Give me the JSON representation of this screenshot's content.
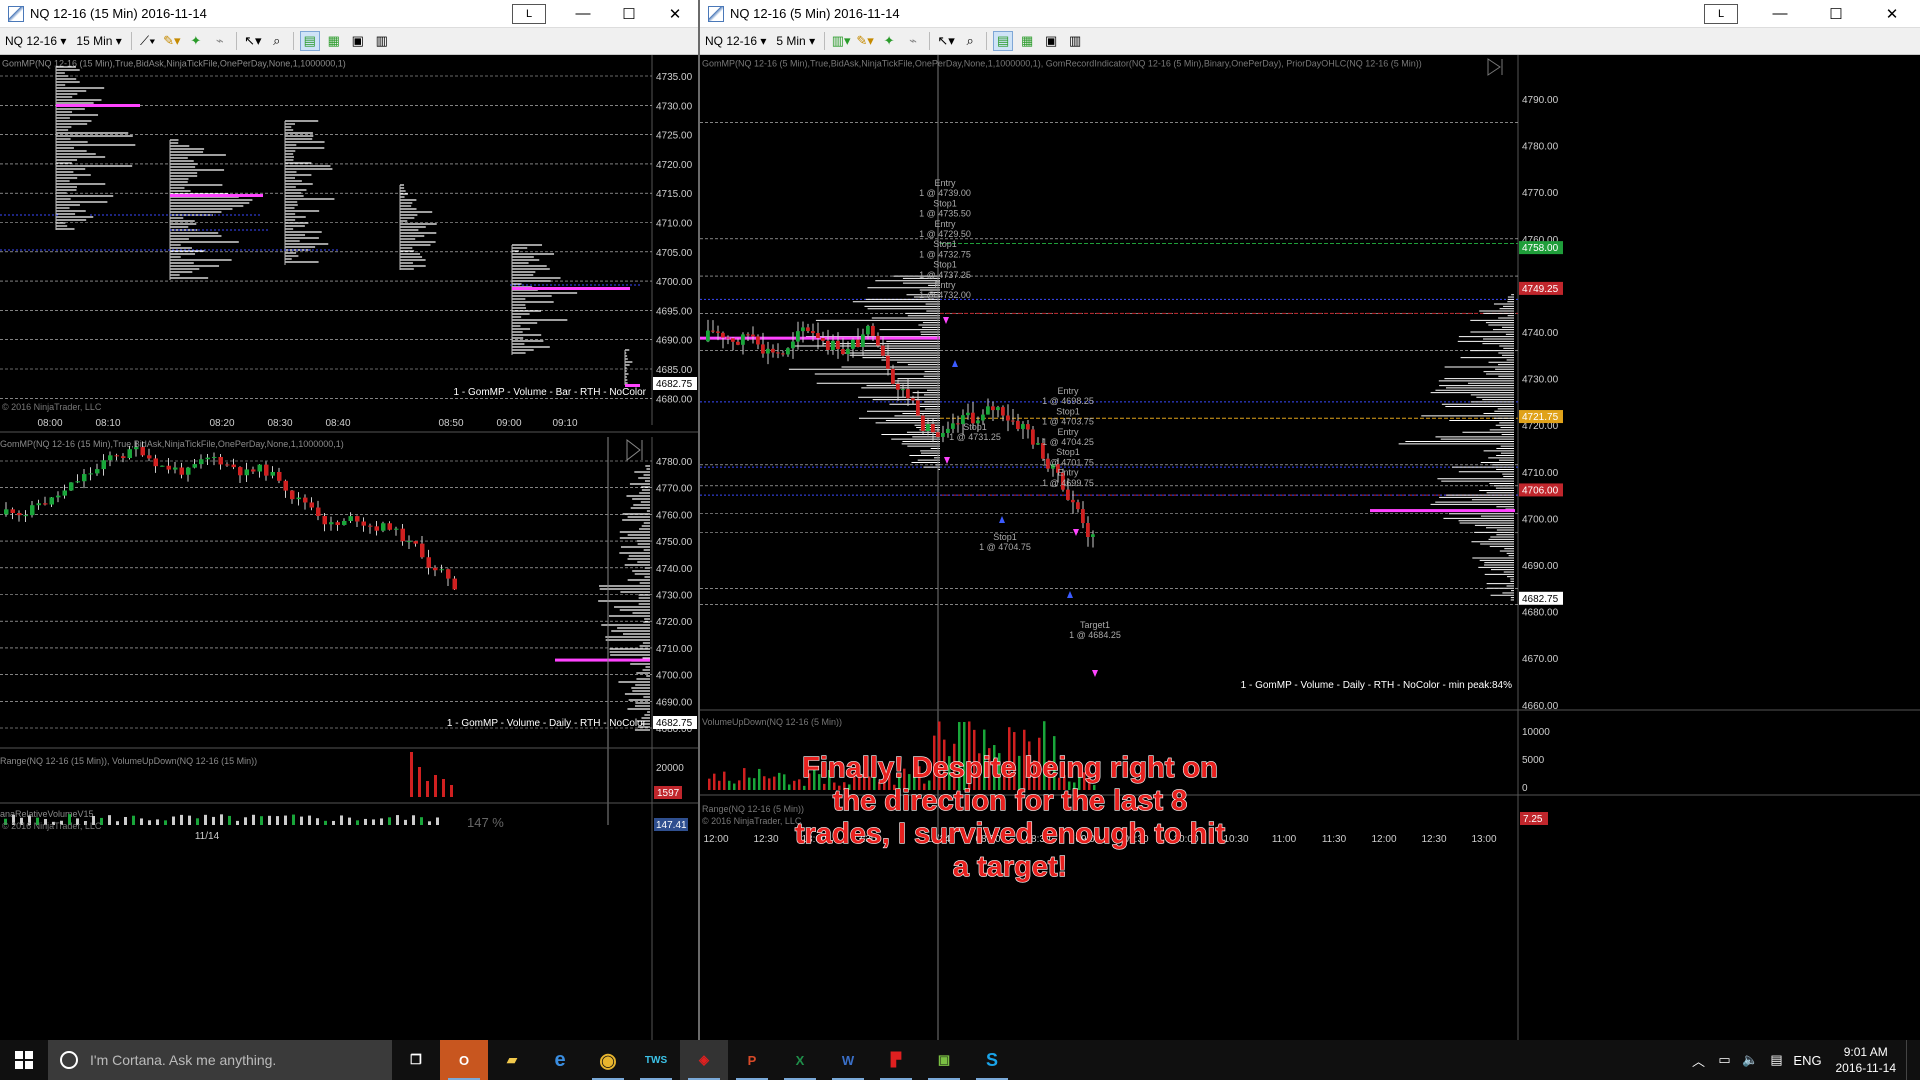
{
  "left_window": {
    "title": "NQ 12-16 (15 Min)  2016-11-14",
    "l_button": "L",
    "toolbar": {
      "instrument": "NQ 12-16",
      "interval": "15 Min"
    },
    "top_panel": {
      "indicator_header": "GomMP(NQ 12-16 (15 Min),True,BidAsk,NinjaTickFile,OnePerDay,None,1,1000000,1)",
      "price_ticks": [
        "4735.00",
        "4730.00",
        "4725.00",
        "4720.00",
        "4715.00",
        "4710.00",
        "4705.00",
        "4700.00",
        "4695.00",
        "4690.00",
        "4685.00",
        "4680.00"
      ],
      "last_price": "4682.75",
      "footer_label": "1 - GomMP - Volume - Bar - RTH - NoColor",
      "copyright": "© 2016 NinjaTrader, LLC",
      "time_ticks": [
        "08:00",
        "08:10",
        "08:20",
        "08:30",
        "08:40",
        "08:50",
        "09:00",
        "09:10"
      ]
    },
    "bottom_panel": {
      "indicator_header": "GomMP(NQ 12-16 (15 Min),True,BidAsk,NinjaTickFile,OnePerDay,None,1,1000000,1)",
      "price_ticks": [
        "4780.00",
        "4770.00",
        "4760.00",
        "4750.00",
        "4740.00",
        "4730.00",
        "4720.00",
        "4710.00",
        "4700.00",
        "4690.00",
        "4680.00"
      ],
      "last_price": "4682.75",
      "footer_label": "1 - GomMP - Volume - Daily - RTH - NoColor",
      "range_header": "Range(NQ 12-16 (15 Min)), VolumeUpDown(NQ 12-16 (15 Min))",
      "range_tick": "20000",
      "range_value": "1597",
      "rel_header": "anaRelativeVolumeV15",
      "copyright": "© 2016 NinjaTrader, LLC",
      "rel_pct": "147 %",
      "rel_value": "147.41",
      "date_tick": "11/14"
    }
  },
  "right_window": {
    "title": "NQ 12-16 (5 Min)  2016-11-14",
    "l_button": "L",
    "toolbar": {
      "instrument": "NQ 12-16",
      "interval": "5 Min"
    },
    "panel": {
      "indicator_header": "GomMP(NQ 12-16 (5 Min),True,BidAsk,NinjaTickFile,OnePerDay,None,1,1000000,1), GomRecordIndicator(NQ 12-16 (5 Min),Binary,OnePerDay), PriorDayOHLC(NQ 12-16 (5 Min))",
      "price_ticks": [
        "4790.00",
        "4780.00",
        "4770.00",
        "4760.00",
        "4750.00",
        "4740.00",
        "4730.00",
        "4720.00",
        "4710.00",
        "4700.00",
        "4690.00",
        "4680.00",
        "4670.00",
        "4660.00"
      ],
      "flags": [
        {
          "text": "4758.00",
          "color": "#1f9e3a"
        },
        {
          "text": "4749.25",
          "color": "#c0262c"
        },
        {
          "text": "4721.75",
          "color": "#e0a21a"
        },
        {
          "text": "4706.00",
          "color": "#c0262c"
        },
        {
          "text": "4682.75",
          "color": "#ffffff"
        }
      ],
      "footer_label": "1 - GomMP - Volume - Daily - RTH - NoColor - min peak:84%",
      "trade_labels": [
        [
          "Entry",
          "1 @ 4739.00",
          "Stop1",
          "1 @ 4735.50",
          "Entry",
          "1 @ 4729.50",
          "Stop1",
          "1 @ 4732.75",
          "Stop1",
          "1 @ 4737.25",
          "Entry",
          "1 @ 4732.00"
        ],
        [
          "Stop1",
          "1 @ 4731.25"
        ],
        [
          "Stop1",
          "1 @ 4704.75"
        ],
        [
          "Entry",
          "1 @ 4698.25",
          "Stop1",
          "1 @ 4703.75",
          "Entry",
          "1 @ 4704.25",
          "Stop1",
          "1 @ 4701.75",
          "Entry",
          "1 @ 4699.75"
        ],
        [
          "Target1",
          "1 @ 4684.25"
        ]
      ],
      "volume_header": "VolumeUpDown(NQ 12-16 (5 Min))",
      "volume_ticks": [
        "10000",
        "5000",
        "0"
      ],
      "range_header": "Range(NQ 12-16 (5 Min))",
      "copyright": "© 2016 NinjaTrader, LLC",
      "range_value": "7.25",
      "time_ticks": [
        "12:00",
        "12:30",
        "13:00",
        "13:30",
        "11/14",
        "08:00",
        "08:30",
        "09:00",
        "09:30",
        "10:00",
        "10:30",
        "11:00",
        "11:30",
        "12:00",
        "12:30",
        "13:00"
      ]
    }
  },
  "annotation": "Finally! Despite being right on the direction for the last 8 trades, I survived enough to hit a target!",
  "taskbar": {
    "cortana_placeholder": "I'm Cortana. Ask me anything.",
    "language": "ENG",
    "time": "9:01 AM",
    "date": "2016-11-14",
    "apps": [
      "task-view-icon",
      "outlook-icon",
      "file-explorer-icon",
      "edge-icon",
      "chrome-icon",
      "tws-icon",
      "ninjatrader-icon",
      "powerpoint-icon",
      "excel-icon",
      "word-icon",
      "acrobat-icon",
      "notepad-plus-icon",
      "skype-icon"
    ]
  },
  "colors": {
    "profile": "#ffffff",
    "poc": "#ff44ff",
    "value_area": "#3a49ff",
    "bull": "#19a63a",
    "bear": "#d02020",
    "grid": "#cfcfcf",
    "accent": "#0078d7"
  }
}
